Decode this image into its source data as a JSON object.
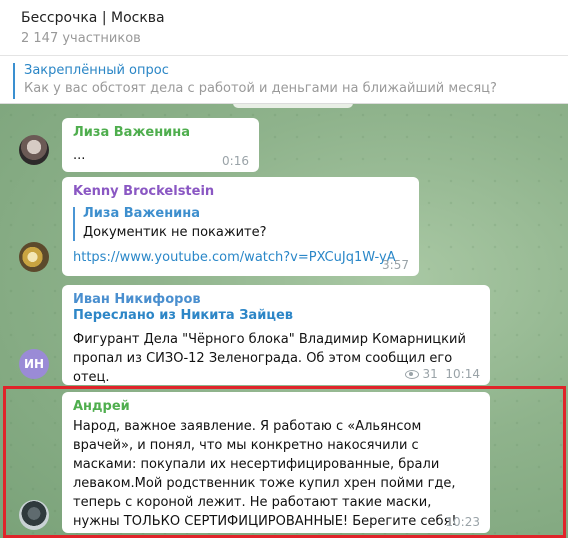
{
  "header": {
    "title": "Бессрочка | Москва",
    "members": "2 147 участников"
  },
  "pinned": {
    "title": "Закреплённый опрос",
    "text": "Как у вас обстоят дела с работой и деньгами на ближайший месяц?"
  },
  "messages": [
    {
      "author": "Лиза Важенина",
      "text": "...",
      "time": "0:16",
      "author_color": "#4fae4e"
    },
    {
      "author": "Kenny Brockelstein",
      "quote_author": "Лиза Важенина",
      "quote_text": "Документик не покажите?",
      "link": "https://www.youtube.com/watch?v=PXCuJq1W-yA",
      "time": "3:57",
      "author_color": "#8a57c3"
    },
    {
      "author": "Иван Никифоров",
      "forwarded": "Переслано из Никита Зайцев",
      "text": "Фигурант Дела \"Чёрного блока\" Владимир Комарницкий пропал из СИЗО-12 Зеленограда. Об этом сообщил его отец.",
      "views": "31",
      "time": "10:14",
      "avatar_initials": "ИН"
    },
    {
      "author": "Андрей",
      "text": "Народ, важное заявление. Я работаю с «Альянсом врачей», и понял, что мы конкретно накосячили с масками: покупали их несертифицированные, брали леваком.Мой родственник тоже купил хрен пойми где, теперь с короной лежит. Не работают такие маски, нужны ТОЛЬКО СЕРТИФИЦИРОВАННЫЕ! Берегите себя!",
      "time": "10:23",
      "author_color": "#4fae4e"
    }
  ],
  "colors": {
    "highlight": "#e0242a",
    "link": "#2a87c8",
    "pinned_bar": "#3a8fd0"
  }
}
